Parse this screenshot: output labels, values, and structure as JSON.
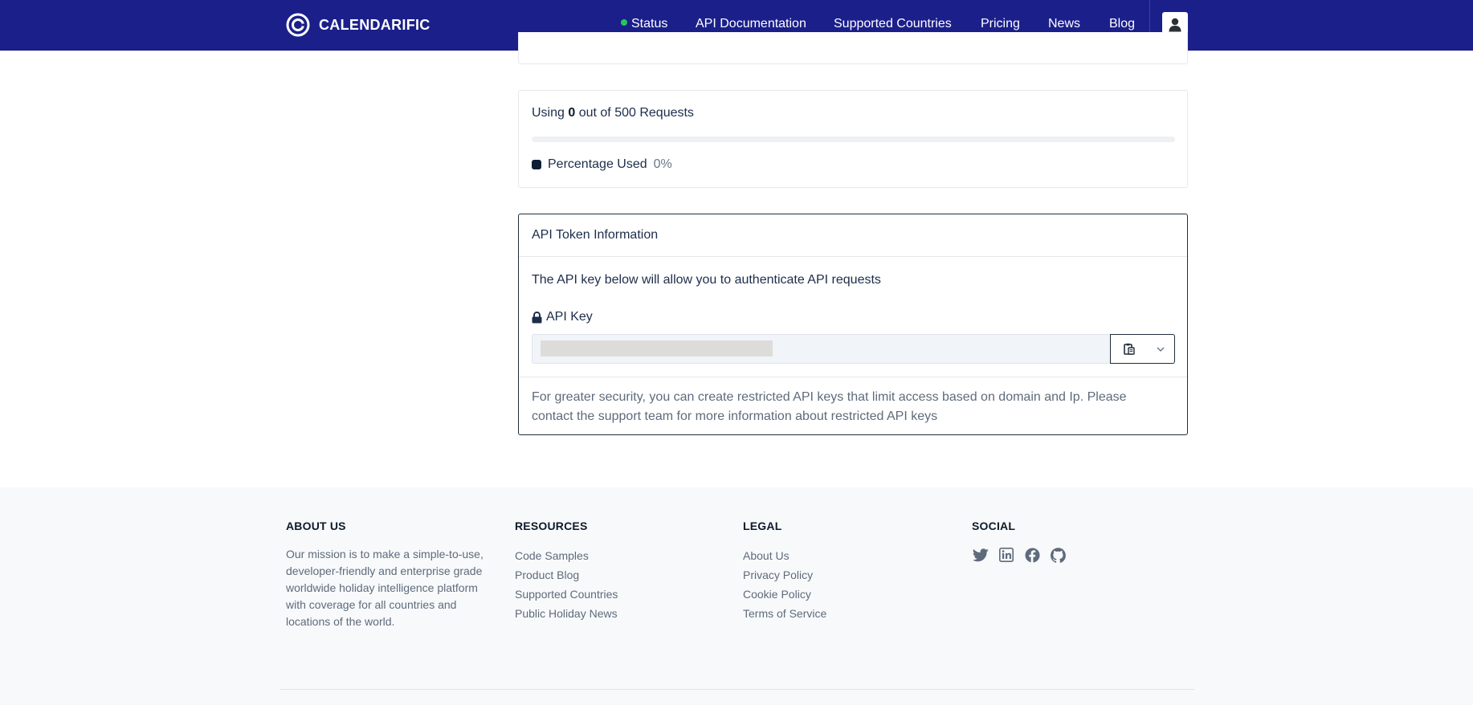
{
  "brand": {
    "name": "CALENDARIFIC"
  },
  "nav": {
    "status": "Status",
    "api_docs": "API Documentation",
    "countries": "Supported Countries",
    "pricing": "Pricing",
    "news": "News",
    "blog": "Blog"
  },
  "usage": {
    "prefix": "Using",
    "used": "0",
    "suffix": "out of 500 Requests",
    "percent_fraction": 0,
    "legend_label": "Percentage Used",
    "legend_value": "0%"
  },
  "token": {
    "title": "API Token Information",
    "description": "The API key below will allow you to authenticate API requests",
    "key_label": "API Key",
    "footer_note": "For greater security, you can create restricted API keys that limit access based on domain and Ip. Please contact the support team for more information about restricted API keys"
  },
  "footer": {
    "about": {
      "title": "ABOUT US",
      "text": "Our mission is to make a simple-to-use, developer-friendly and enterprise grade worldwide holiday intelligence platform with coverage for all countries and locations of the world."
    },
    "resources": {
      "title": "RESOURCES",
      "links": [
        "Code Samples",
        "Product Blog",
        "Supported Countries",
        "Public Holiday News"
      ]
    },
    "legal": {
      "title": "LEGAL",
      "links": [
        "About Us",
        "Privacy Policy",
        "Cookie Policy",
        "Terms of Service"
      ]
    },
    "social": {
      "title": "SOCIAL",
      "icons": [
        "twitter-icon",
        "linkedin-icon",
        "facebook-icon",
        "github-icon"
      ]
    }
  },
  "colors": {
    "navbar": "#1b1f8a",
    "status_dot": "#27c75a",
    "legend_swatch": "#0f1e36"
  }
}
